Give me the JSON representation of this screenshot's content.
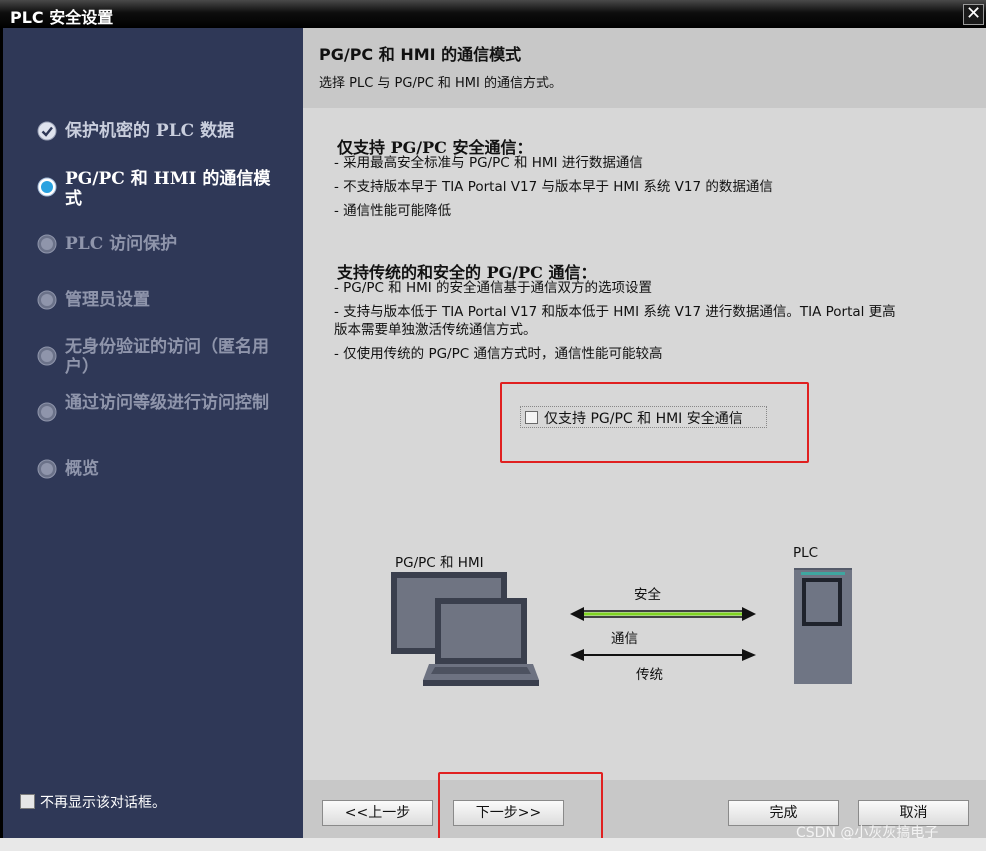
{
  "window": {
    "title": "PLC 安全设置",
    "close_glyph": "✕"
  },
  "sidebar": {
    "items": [
      {
        "label": "保护机密的 PLC 数据",
        "state": "done",
        "icon": "check-circle-icon"
      },
      {
        "label": "PG/PC 和 HMI 的通信模式",
        "state": "active",
        "icon": "radio-active-icon"
      },
      {
        "label": "PLC 访问保护",
        "state": "pending",
        "icon": "radio-icon"
      },
      {
        "label": "管理员设置",
        "state": "pending",
        "icon": "radio-icon"
      },
      {
        "label": "无身份验证的访问（匿名用户）",
        "state": "pending",
        "icon": "radio-icon"
      },
      {
        "label": "通过访问等级进行访问控制",
        "state": "pending",
        "icon": "radio-icon"
      },
      {
        "label": "概览",
        "state": "pending",
        "icon": "radio-icon"
      }
    ],
    "dont_show_label": "不再显示该对话框。",
    "dont_show_checked": false
  },
  "header": {
    "title": "PG/PC 和 HMI 的通信模式",
    "subtitle": "选择 PLC 与 PG/PC 和 HMI 的通信方式。"
  },
  "content": {
    "section1": {
      "title": "仅支持 PG/PC 安全通信：",
      "bullets": [
        "- 采用最高安全标准与 PG/PC 和 HMI 进行数据通信",
        "- 不支持版本早于 TIA Portal V17 与版本早于 HMI 系统 V17 的数据通信",
        "- 通信性能可能降低"
      ]
    },
    "section2": {
      "title": "支持传统的和安全的 PG/PC 通信：",
      "bullets": [
        "- PG/PC 和 HMI 的安全通信基于通信双方的选项设置",
        "- 支持与版本低于 TIA Portal V17 和版本低于 HMI 系统 V17 进行数据通信。TIA Portal 更高",
        "版本需要单独激活传统通信方式。",
        "- 仅使用传统的 PG/PC 通信方式时，通信性能可能较高"
      ]
    },
    "option": {
      "label": "仅支持 PG/PC 和 HMI 安全通信",
      "checked": false
    },
    "diagram": {
      "left_label": "PG/PC 和 HMI",
      "right_label": "PLC",
      "arrow_top_label": "安全",
      "arrow_middle_label": "通信",
      "arrow_bottom_label": "传统",
      "secure_line_color": "#7fd321"
    }
  },
  "footer": {
    "back": "<<上一步",
    "next": "下一步>>",
    "finish": "完成",
    "cancel": "取消"
  },
  "watermark": "CSDN @小灰灰搞电子",
  "colors": {
    "sidebar_bg": "#2f3857",
    "highlight_red": "#e02020",
    "content_bg": "#d7d7d7"
  }
}
